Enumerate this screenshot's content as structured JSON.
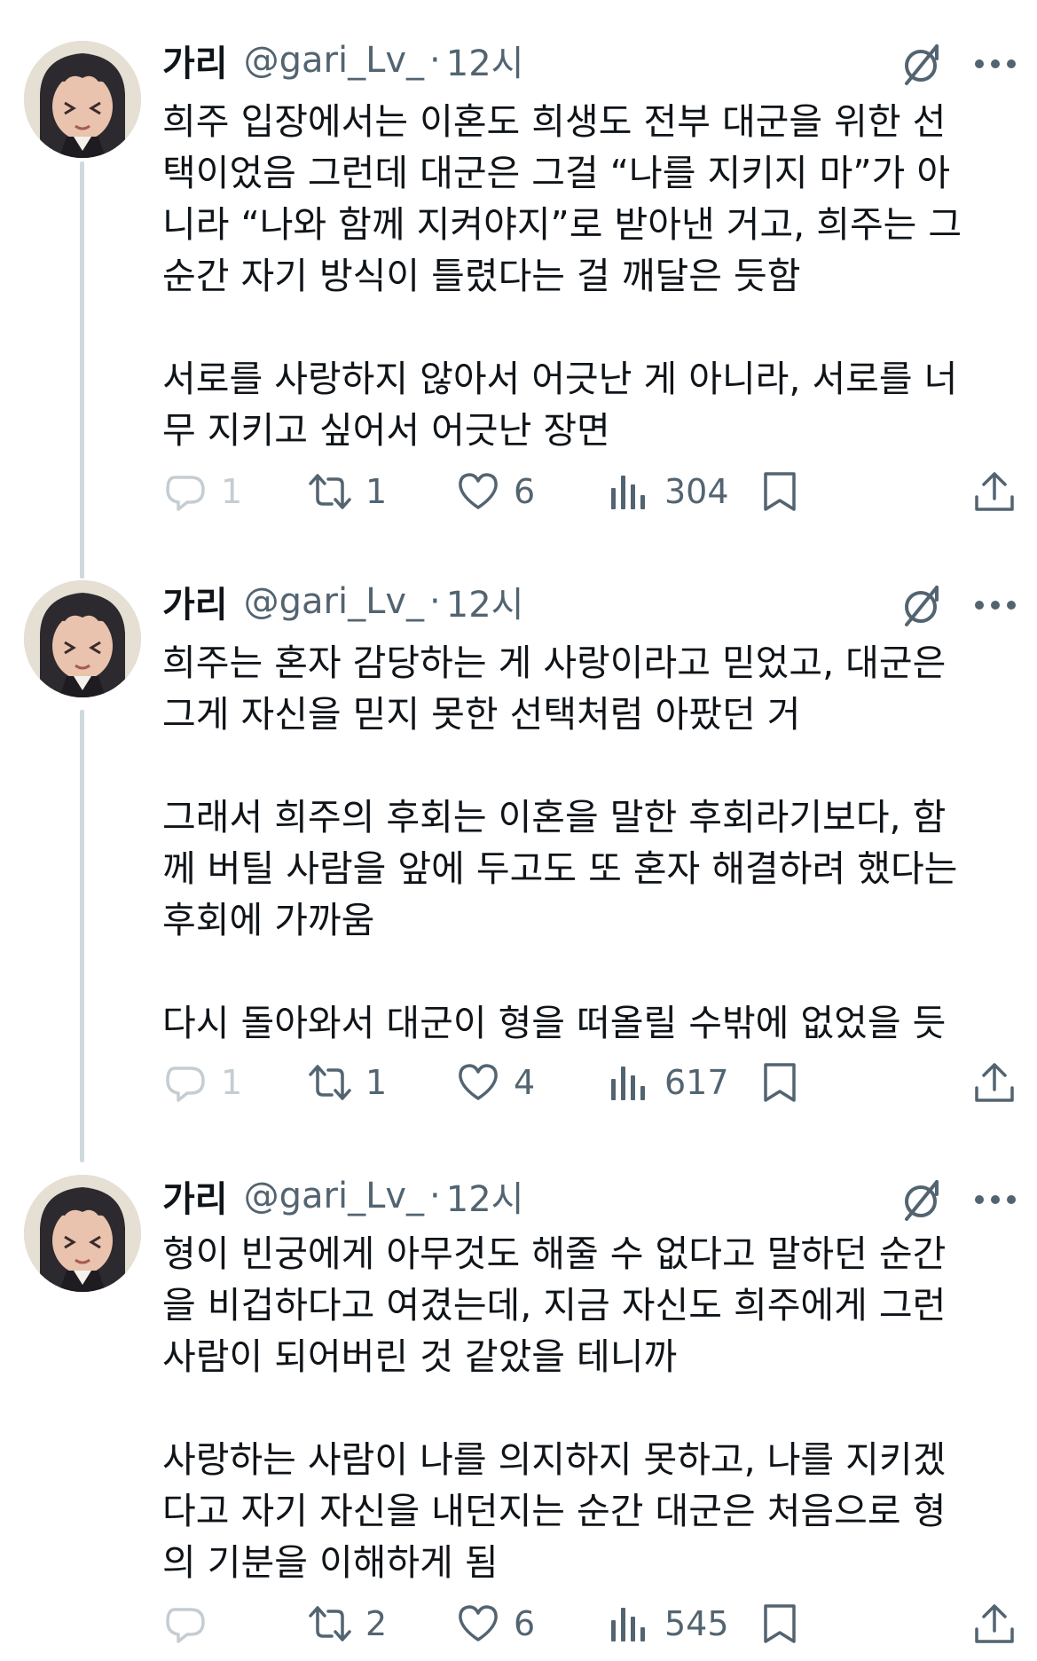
{
  "tweets": [
    {
      "display_name": "가리",
      "handle": "@gari_Lv_",
      "separator": "·",
      "time": "12시",
      "lines": [
        "희주 입장에서는 이혼도 희생도 전부 대군을 위한 선",
        "택이었음 그런데 대군은 그걸 “나를 지키지 마”가 아",
        "니라 “나와 함께 지켜야지”로 받아낸 거고, 희주는 그",
        "순간 자기 방식이 틀렸다는 걸 깨달은 듯함",
        "",
        "서로를 사랑하지 않아서 어긋난 게 아니라, 서로를 너",
        "무 지키고 싶어서 어긋난 장면"
      ],
      "replies": "1",
      "reposts": "1",
      "likes": "6",
      "views": "304"
    },
    {
      "display_name": "가리",
      "handle": "@gari_Lv_",
      "separator": "·",
      "time": "12시",
      "lines": [
        "희주는 혼자 감당하는 게 사랑이라고 믿었고, 대군은",
        "그게 자신을 믿지 못한 선택처럼 아팠던 거",
        "",
        "그래서 희주의 후회는 이혼을 말한 후회라기보다, 함",
        "께 버틸 사람을 앞에 두고도 또 혼자 해결하려 했다는",
        "후회에 가까움",
        "",
        "다시 돌아와서 대군이 형을 떠올릴 수밖에 없었을 듯"
      ],
      "replies": "1",
      "reposts": "1",
      "likes": "4",
      "views": "617"
    },
    {
      "display_name": "가리",
      "handle": "@gari_Lv_",
      "separator": "·",
      "time": "12시",
      "lines": [
        "형이 빈궁에게 아무것도 해줄 수 없다고 말하던 순간",
        "을 비겁하다고 여겼는데, 지금 자신도 희주에게 그런",
        "사람이 되어버린 것 같았을 테니까",
        "",
        "사랑하는 사람이 나를 의지하지 못하고, 나를 지키겠",
        "다고 자기 자신을 내던지는 순간 대군은 처음으로 형",
        "의 기분을 이해하게 됨"
      ],
      "replies": "",
      "reposts": "2",
      "likes": "6",
      "views": "545"
    }
  ],
  "icons": {
    "grok": "grok-slash-icon",
    "more": "more-dots-icon",
    "reply": "reply-bubble-icon",
    "repost": "repost-icon",
    "like": "heart-icon",
    "views": "views-bar-icon",
    "bookmark": "bookmark-icon",
    "share": "share-icon"
  },
  "colors": {
    "text": "#0f1419",
    "muted": "#536471",
    "faded": "#c5cdd3",
    "thread_line": "#cfd9de"
  }
}
